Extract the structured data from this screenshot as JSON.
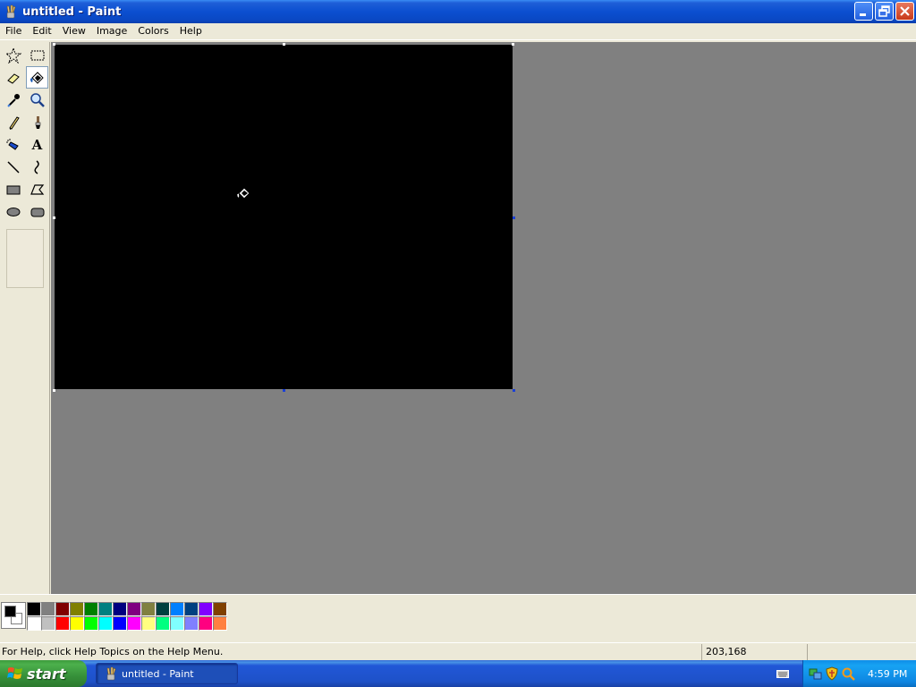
{
  "window": {
    "title": "untitled - Paint",
    "buttons": [
      "minimize",
      "restore",
      "close"
    ]
  },
  "menu": {
    "items": [
      "File",
      "Edit",
      "View",
      "Image",
      "Colors",
      "Help"
    ]
  },
  "toolbox": {
    "tools": [
      {
        "name": "free-form-select",
        "icon": "star-select-icon"
      },
      {
        "name": "select",
        "icon": "rect-select-icon"
      },
      {
        "name": "eraser",
        "icon": "eraser-icon"
      },
      {
        "name": "fill-with-color",
        "icon": "paint-bucket-icon",
        "selected": true
      },
      {
        "name": "pick-color",
        "icon": "eyedropper-icon"
      },
      {
        "name": "magnifier",
        "icon": "magnifier-icon"
      },
      {
        "name": "pencil",
        "icon": "pencil-icon"
      },
      {
        "name": "brush",
        "icon": "brush-icon"
      },
      {
        "name": "airbrush",
        "icon": "airbrush-icon"
      },
      {
        "name": "text",
        "icon": "text-icon",
        "glyph": "A"
      },
      {
        "name": "line",
        "icon": "line-icon"
      },
      {
        "name": "curve",
        "icon": "curve-icon"
      },
      {
        "name": "rectangle",
        "icon": "rectangle-icon"
      },
      {
        "name": "polygon",
        "icon": "polygon-icon"
      },
      {
        "name": "ellipse",
        "icon": "ellipse-icon"
      },
      {
        "name": "rounded-rectangle",
        "icon": "rounded-rect-icon"
      }
    ]
  },
  "canvas": {
    "fill_color": "#000000"
  },
  "colors": {
    "foreground": "#000000",
    "background": "#ffffff",
    "palette_top": [
      "#000000",
      "#808080",
      "#800000",
      "#808000",
      "#008000",
      "#008080",
      "#000080",
      "#800080",
      "#808040",
      "#004040",
      "#0080ff",
      "#004080",
      "#8000ff",
      "#804000"
    ],
    "palette_bottom": [
      "#ffffff",
      "#c0c0c0",
      "#ff0000",
      "#ffff00",
      "#00ff00",
      "#00ffff",
      "#0000ff",
      "#ff00ff",
      "#ffff80",
      "#00ff80",
      "#80ffff",
      "#8080ff",
      "#ff0080",
      "#ff8040"
    ]
  },
  "status": {
    "help_text": "For Help, click Help Topics on the Help Menu.",
    "coords": "203,168",
    "size": ""
  },
  "taskbar": {
    "start_label": "start",
    "task_label": "untitled - Paint",
    "clock": "4:59 PM"
  }
}
